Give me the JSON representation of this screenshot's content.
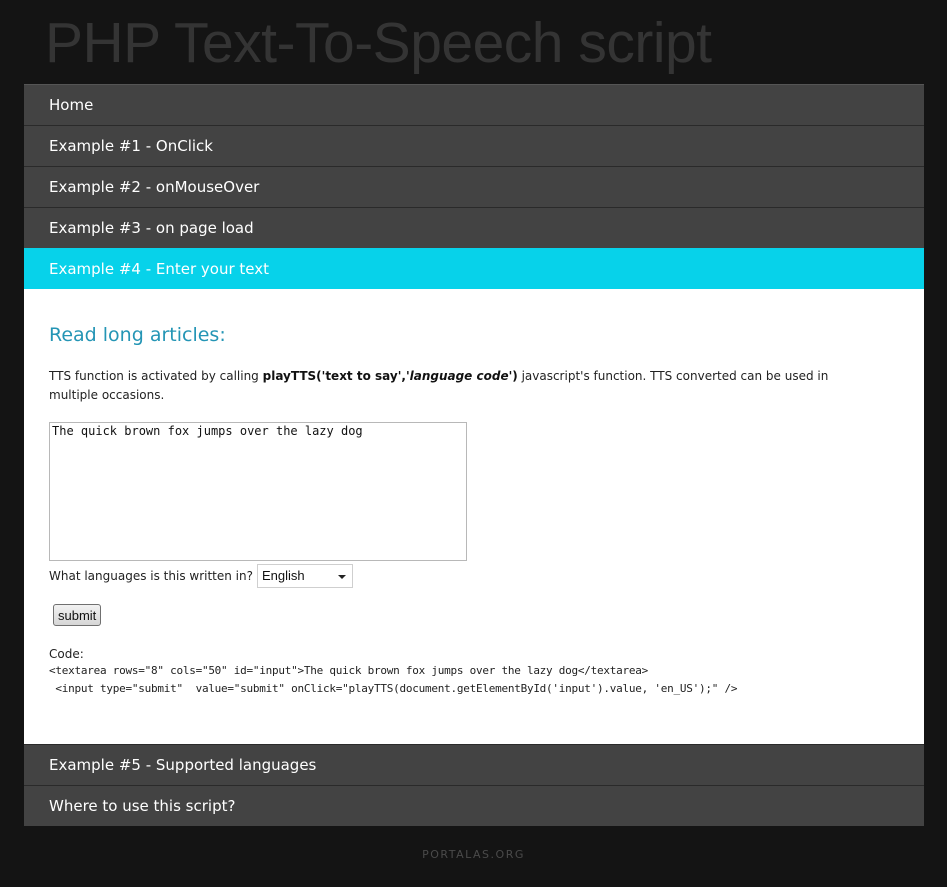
{
  "site": {
    "title": "PHP Text-To-Speech script"
  },
  "menu": {
    "items": [
      {
        "label": "Home"
      },
      {
        "label": "Example #1 - OnClick"
      },
      {
        "label": "Example #2 - onMouseOver"
      },
      {
        "label": "Example #3 - on page load"
      },
      {
        "label": "Example #4 - Enter your text",
        "active": true
      },
      {
        "label": "Example #5 - Supported languages"
      },
      {
        "label": "Where to use this script?"
      }
    ]
  },
  "panel": {
    "heading": "Read long articles:",
    "desc_prefix": "TTS function is activated by calling ",
    "desc_func": "playTTS(",
    "desc_arg1": "'text to say'",
    "desc_comma": ",",
    "desc_arg2": "'language code'",
    "desc_close": ")",
    "desc_suffix": " javascript's function. TTS converted can be used in multiple occasions.",
    "textarea_value": "The quick brown fox jumps over the lazy dog",
    "language_label": "What languages is this written in?",
    "language_selected": "English",
    "submit_label": "submit",
    "code_label": "Code:",
    "code_lines": [
      "<textarea rows=\"8\" cols=\"50\" id=\"input\">The quick brown fox jumps over the lazy dog</textarea>",
      " <input type=\"submit\"  value=\"submit\" onClick=\"playTTS(document.getElementById('input').value, 'en_US');\" />"
    ]
  },
  "footer": {
    "text": "PORTALAS.ORG"
  },
  "colors": {
    "background": "#141414",
    "menu_item": "#434343",
    "menu_active": "#07d2ea",
    "heading": "#2495b5"
  }
}
